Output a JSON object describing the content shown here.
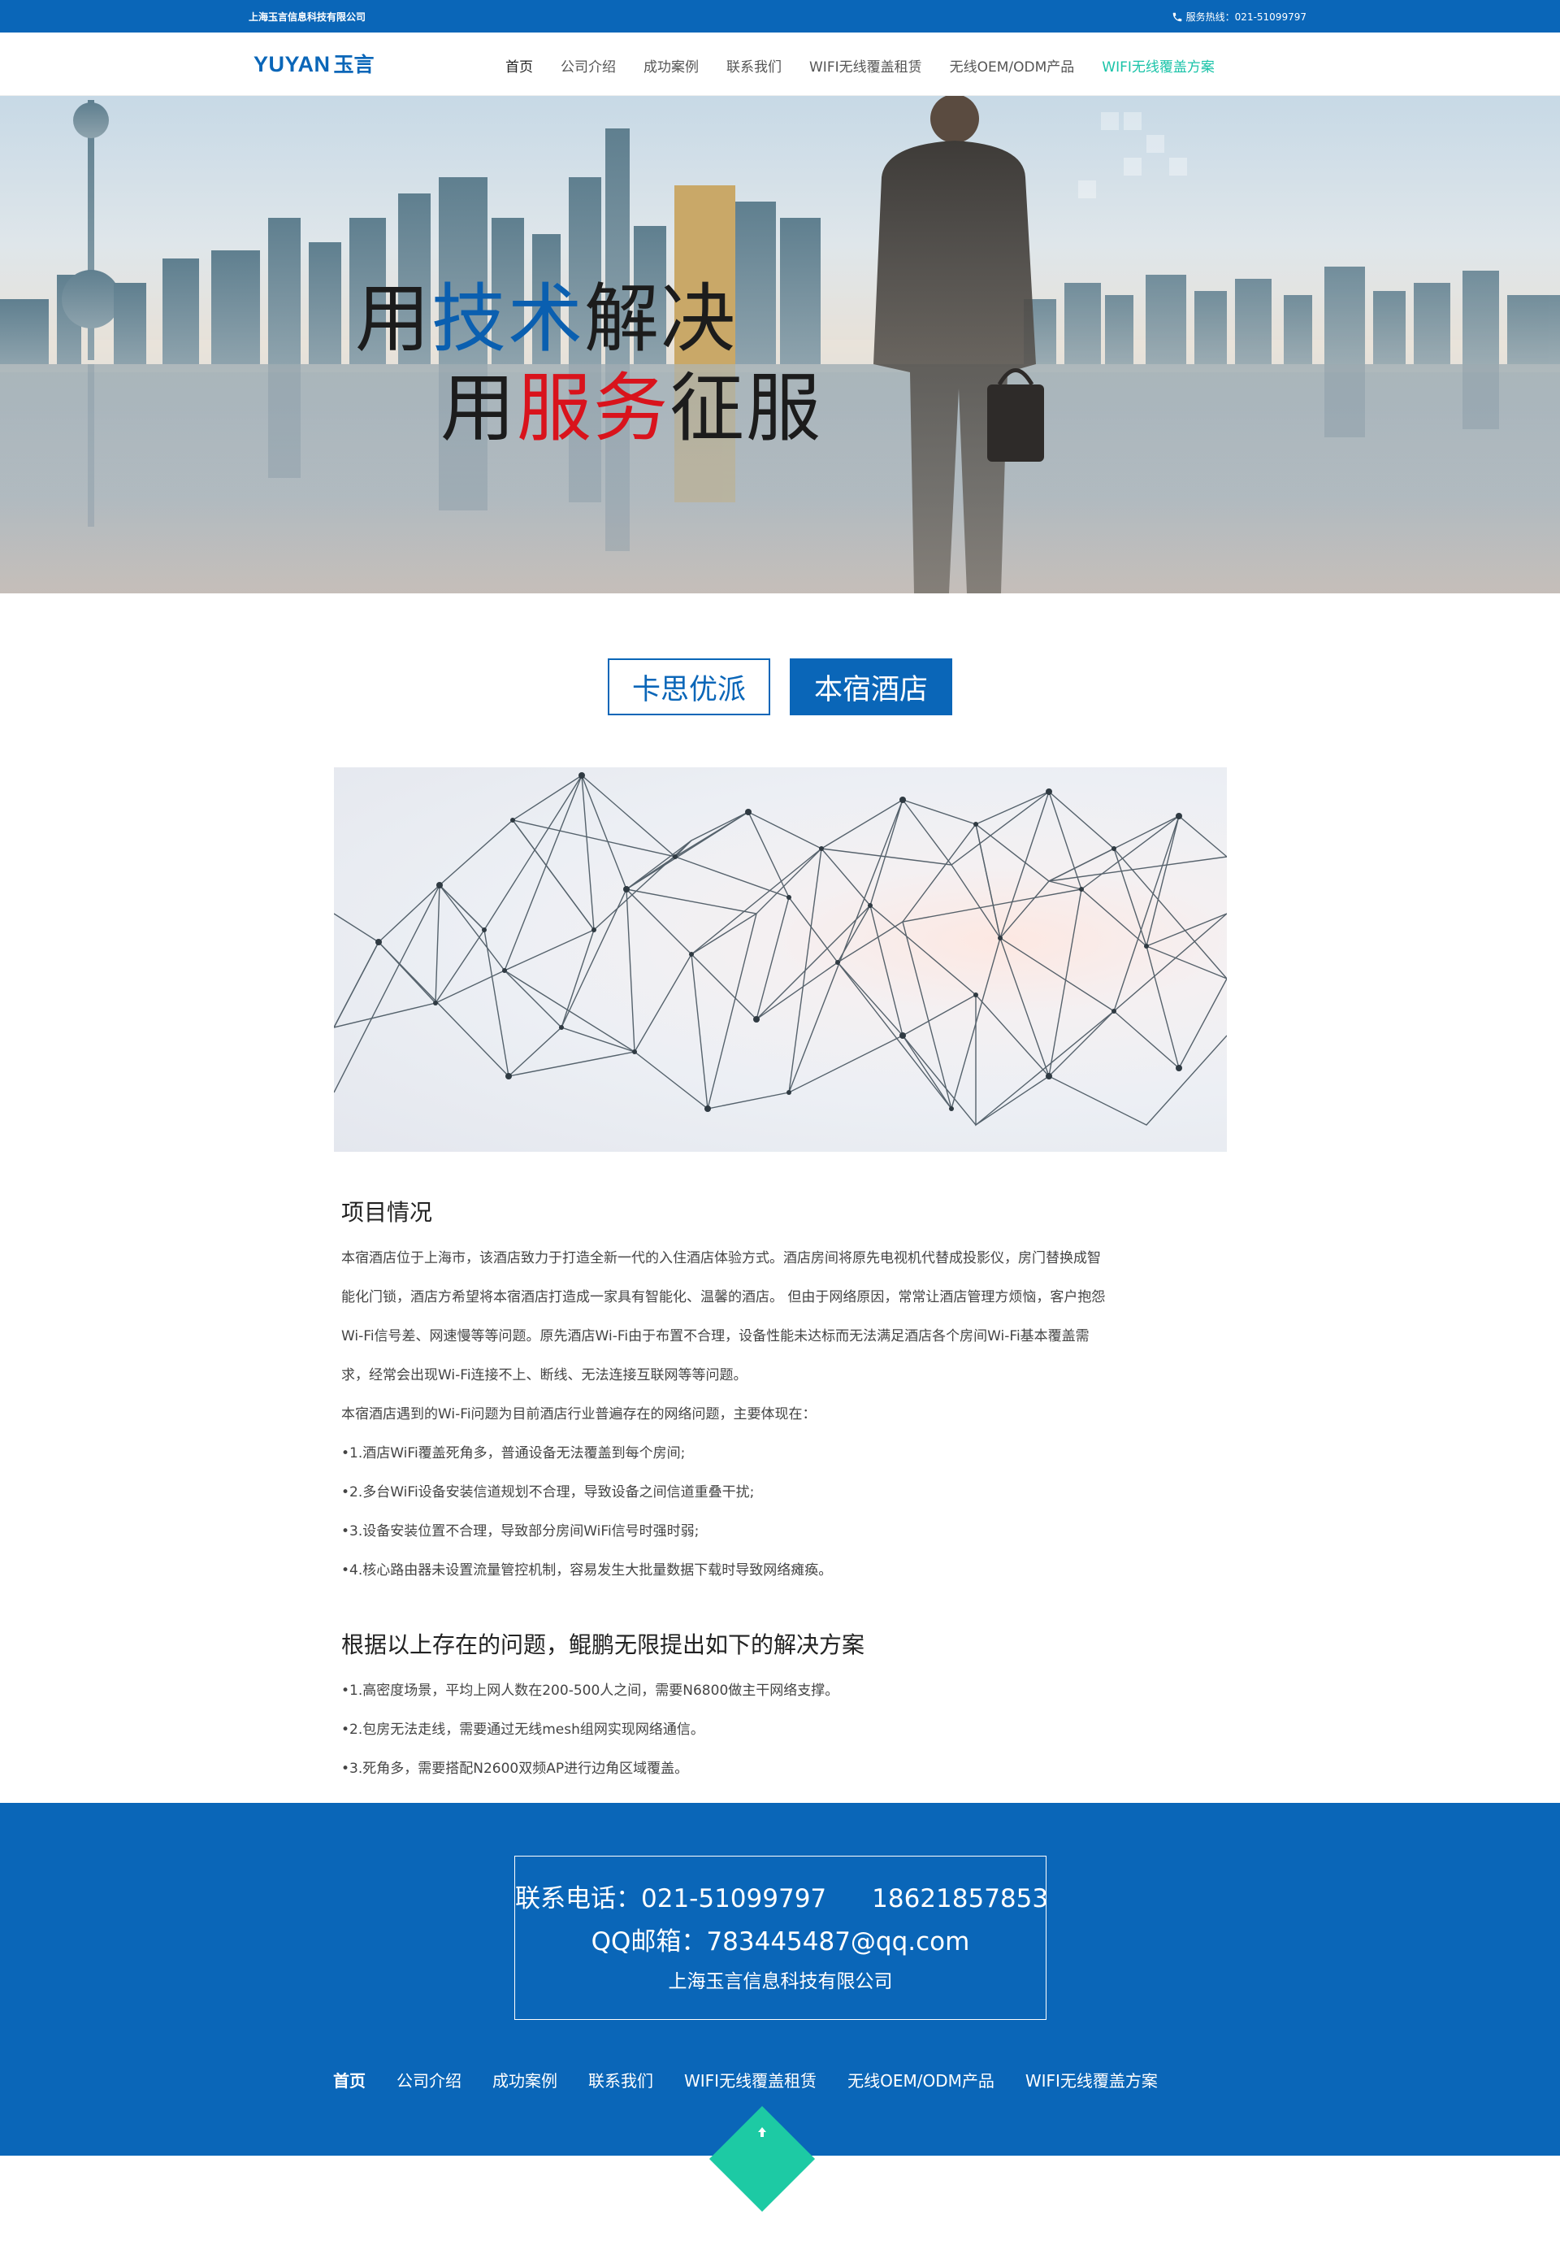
{
  "topbar": {
    "company": "上海玉言信息科技有限公司",
    "hotline": "服务热线：021-51099797"
  },
  "logo": {
    "en": "YUYAN",
    "cn": "玉言"
  },
  "nav": [
    {
      "label": "首页"
    },
    {
      "label": "公司介绍"
    },
    {
      "label": "成功案例"
    },
    {
      "label": "联系我们"
    },
    {
      "label": "WIFI无线覆盖租赁"
    },
    {
      "label": "无线OEM/ODM产品"
    },
    {
      "label": "WIFI无线覆盖方案"
    }
  ],
  "banner": {
    "line1_a": "用",
    "line1_b": "技术",
    "line1_c": "解决",
    "line2_a": "用",
    "line2_b": "服务",
    "line2_c": "征服"
  },
  "tabs": [
    {
      "label": "卡思优派"
    },
    {
      "label": "本宿酒店"
    }
  ],
  "article": {
    "title1": "项目情况",
    "p1": [
      "本宿酒店位于上海市，该酒店致力于打造全新一代的入住酒店体验方式。酒店房间将原先电视机代替成投影仪，房门替换成智",
      "能化门锁，酒店方希望将本宿酒店打造成一家具有智能化、温馨的酒店。 但由于网络原因，常常让酒店管理方烦恼，客户抱怨",
      "Wi-Fi信号差、网速慢等等问题。原先酒店Wi-Fi由于布置不合理，设备性能未达标而无法满足酒店各个房间Wi-Fi基本覆盖需",
      "求，经常会出现Wi-Fi连接不上、断线、无法连接互联网等等问题。",
      "本宿酒店遇到的Wi-Fi问题为目前酒店行业普遍存在的网络问题，主要体现在：",
      "•1.酒店WiFi覆盖死角多，普通设备无法覆盖到每个房间;",
      "•2.多台WiFi设备安装信道规划不合理，导致设备之间信道重叠干扰;",
      "•3.设备安装位置不合理，导致部分房间WiFi信号时强时弱;",
      "•4.核心路由器未设置流量管控机制，容易发生大批量数据下载时导致网络瘫痪。"
    ],
    "title2": "根据以上存在的问题，鲲鹏无限提出如下的解决方案",
    "p2": [
      "•1.高密度场景，平均上网人数在200-500人之间，需要N6800做主干网络支撑。",
      "•2.包房无法走线，需要通过无线mesh组网实现网络通信。",
      "•3.死角多，需要搭配N2600双频AP进行边角区域覆盖。"
    ]
  },
  "footer": {
    "phone_label": "联系电话：021-51099797",
    "mobile": "18621857853",
    "email": "QQ邮箱：783445487@qq.com",
    "company": "上海玉言信息科技有限公司",
    "nav": [
      {
        "label": "首页"
      },
      {
        "label": "公司介绍"
      },
      {
        "label": "成功案例"
      },
      {
        "label": "联系我们"
      },
      {
        "label": "WIFI无线覆盖租赁"
      },
      {
        "label": "无线OEM/ODM产品"
      },
      {
        "label": "WIFI无线覆盖方案"
      }
    ]
  },
  "colors": {
    "brand": "#0a66b8",
    "accent": "#19c3a8",
    "highlight_red": "#d9131c"
  },
  "icons": {
    "phone": "phone-icon",
    "back_to_top": "arrow-up-icon"
  }
}
